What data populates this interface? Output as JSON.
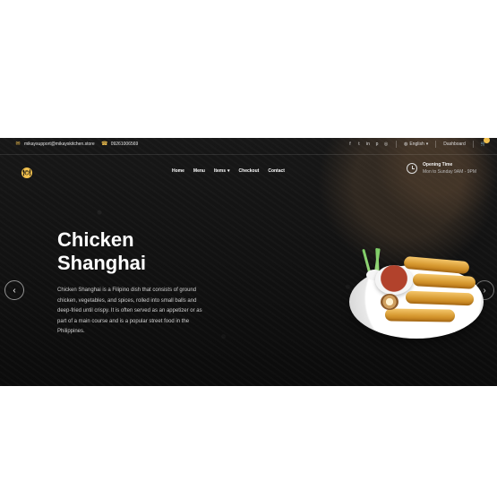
{
  "topbar": {
    "email": "mikaysupport@mikayskitchen.store",
    "phone": "09261006569",
    "social_icons": [
      "facebook-icon",
      "twitter-icon",
      "linkedin-icon",
      "pinterest-icon",
      "dribbble-icon"
    ],
    "language": "English",
    "dashboard": "Dashboard"
  },
  "nav": {
    "items": [
      "Home",
      "Menu",
      "Items",
      "Checkout",
      "Contact"
    ],
    "opening_label": "Opening Time",
    "opening_time": "Mon to Sunday 9AM - 9PM"
  },
  "hero": {
    "title": "Chicken Shanghai",
    "description": "Chicken Shanghai is a Filipino dish that consists of ground chicken, vegetables, and spices, rolled into small balls and deep-fried until crispy. It is often served as an appetizer or as part of a main course and is a popular street food in the Philippines."
  },
  "colors": {
    "accent": "#f2c14e",
    "background": "#111111",
    "text_light": "#ffffff"
  }
}
